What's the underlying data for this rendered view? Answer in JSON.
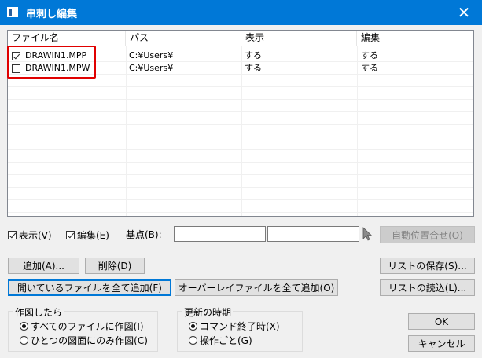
{
  "window": {
    "title": "串刺し編集",
    "close_glyph": "✕"
  },
  "list": {
    "columns": [
      "ファイル名",
      "パス",
      "表示",
      "編集"
    ],
    "rows": [
      {
        "checked": true,
        "file": "DRAWIN1.MPP",
        "path": "C:¥Users¥",
        "display": "する",
        "edit": "する"
      },
      {
        "checked": false,
        "file": "DRAWIN1.MPW",
        "path": "C:¥Users¥",
        "display": "する",
        "edit": "する"
      }
    ]
  },
  "options": {
    "show_label": "表示(V)",
    "show_checked": true,
    "edit_label": "編集(E)",
    "edit_checked": true,
    "basepoint_label": "基点(B):",
    "basepoint_x": "",
    "basepoint_y": "",
    "auto_align_label": "自動位置合せ(O)"
  },
  "buttons": {
    "add": "追加(A)...",
    "delete": "削除(D)",
    "add_all_open": "開いているファイルを全て追加(F)",
    "add_all_overlay": "オーバーレイファイルを全て追加(O)",
    "save_list": "リストの保存(S)...",
    "load_list": "リストの読込(L)...",
    "ok": "OK",
    "cancel": "キャンセル"
  },
  "draw_group": {
    "title": "作図したら",
    "options": [
      {
        "label": "すべてのファイルに作図(I)",
        "selected": true
      },
      {
        "label": "ひとつの図面にのみ作図(C)",
        "selected": false
      }
    ]
  },
  "update_group": {
    "title": "更新の時期",
    "options": [
      {
        "label": "コマンド終了時(X)",
        "selected": true
      },
      {
        "label": "操作ごと(G)",
        "selected": false
      }
    ]
  },
  "colors": {
    "titlebar": "#0078d7",
    "highlight": "#e00000",
    "dialog_bg": "#f0f0f0"
  }
}
